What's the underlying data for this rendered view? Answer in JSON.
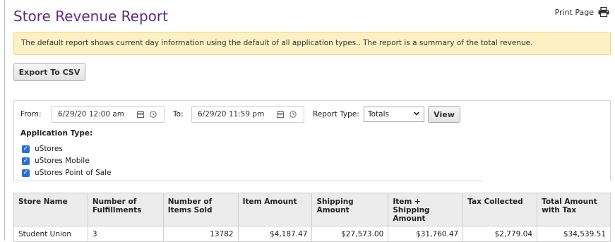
{
  "page": {
    "title": "Store Revenue Report",
    "print_label": "Print Page",
    "print_icon": "printer-icon"
  },
  "notice": {
    "text": "The default report shows current day information using the default of all application types.. The report is a summary of the total revenue."
  },
  "export_button": {
    "label": "Export To CSV"
  },
  "filters": {
    "from_label": "From:",
    "from_value": "6/29/20 12:00 am",
    "to_label": "To:",
    "to_value": "6/29/20 11:59 pm",
    "calendar_icon": "calendar-icon",
    "clock_icon": "clock-icon",
    "report_type_label": "Report Type:",
    "report_type_value": "Totals",
    "view_label": "View",
    "application_type_label": "Application Type:",
    "application_types": [
      {
        "label": "uStores",
        "checked": true
      },
      {
        "label": "uStores Mobile",
        "checked": true
      },
      {
        "label": "uStores Point of Sale",
        "checked": true
      }
    ]
  },
  "table": {
    "headers": [
      "Store Name",
      "Number of Fulfillments",
      "Number of Items Sold",
      "Item Amount",
      "Shipping Amount",
      "Item + Shipping Amount",
      "Tax Collected",
      "Total Amount with Tax"
    ],
    "rows": [
      [
        "Student Union",
        "3",
        "13782",
        "$4,187.47",
        "$27,573.00",
        "$31,760.47",
        "$2,779.04",
        "$34,539.51"
      ]
    ]
  },
  "colors": {
    "title": "#5a2d82",
    "notice_bg": "#fcf0c4",
    "notice_border": "#f2d77a",
    "checkbox": "#2b6fd6",
    "table_header_bg": "#ececec"
  }
}
